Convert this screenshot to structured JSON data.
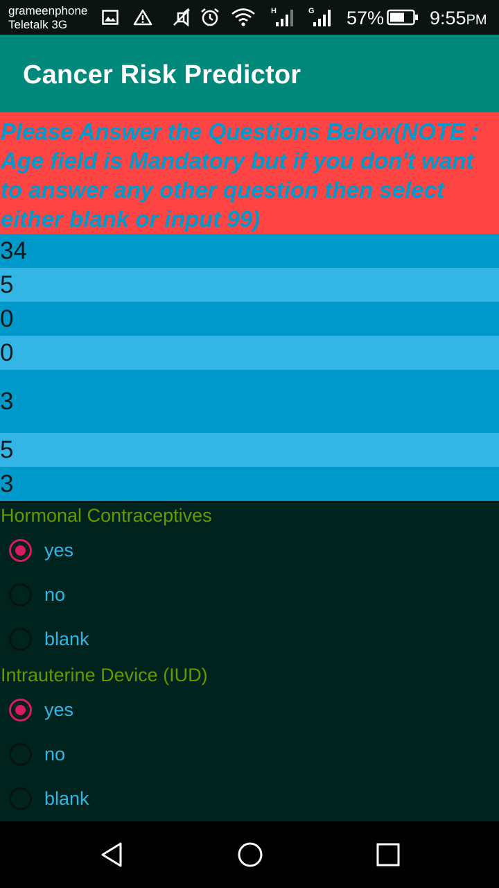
{
  "status_bar": {
    "carrier_1": "grameenphone",
    "carrier_2": "Teletalk 3G",
    "battery_percent": "57%",
    "time": "9:55",
    "time_suffix": "PM",
    "signal_1_label": "H",
    "signal_2_label": "G",
    "icons": [
      "image-icon",
      "warning-icon",
      "mute-icon",
      "alarm-icon",
      "wifi-icon",
      "signal-icon",
      "signal-icon",
      "battery-icon"
    ]
  },
  "app_bar": {
    "title": "Cancer Risk Predictor"
  },
  "note": {
    "text": "Please Answer the Questions Below(NOTE : Age field is Mandatory but if you don't want to answer any other question then select either blank or input 99)"
  },
  "fields": [
    {
      "value": "34"
    },
    {
      "value": "5"
    },
    {
      "value": "0"
    },
    {
      "value": "0"
    },
    {
      "value": "3"
    },
    {
      "value": "5"
    },
    {
      "value": "3"
    }
  ],
  "hormonal": {
    "label": "Hormonal Contraceptives",
    "options": [
      "yes",
      "no",
      "blank"
    ],
    "selected": "yes"
  },
  "iud": {
    "label": "Intrauterine Device (IUD)",
    "options": [
      "yes",
      "no",
      "blank"
    ],
    "selected": "yes"
  },
  "colors": {
    "app_bar": "#00887a",
    "note_background": "#ff4444",
    "note_text": "#0099cc",
    "field_dark": "#0099cc",
    "field_light": "#33b5e5",
    "section_label": "#669900",
    "radio_checked": "#d81b60",
    "radio_label": "#33b5e5",
    "background": "#00231e"
  },
  "nav_bar": {
    "icons": [
      "back-icon",
      "home-icon",
      "recents-icon"
    ]
  }
}
